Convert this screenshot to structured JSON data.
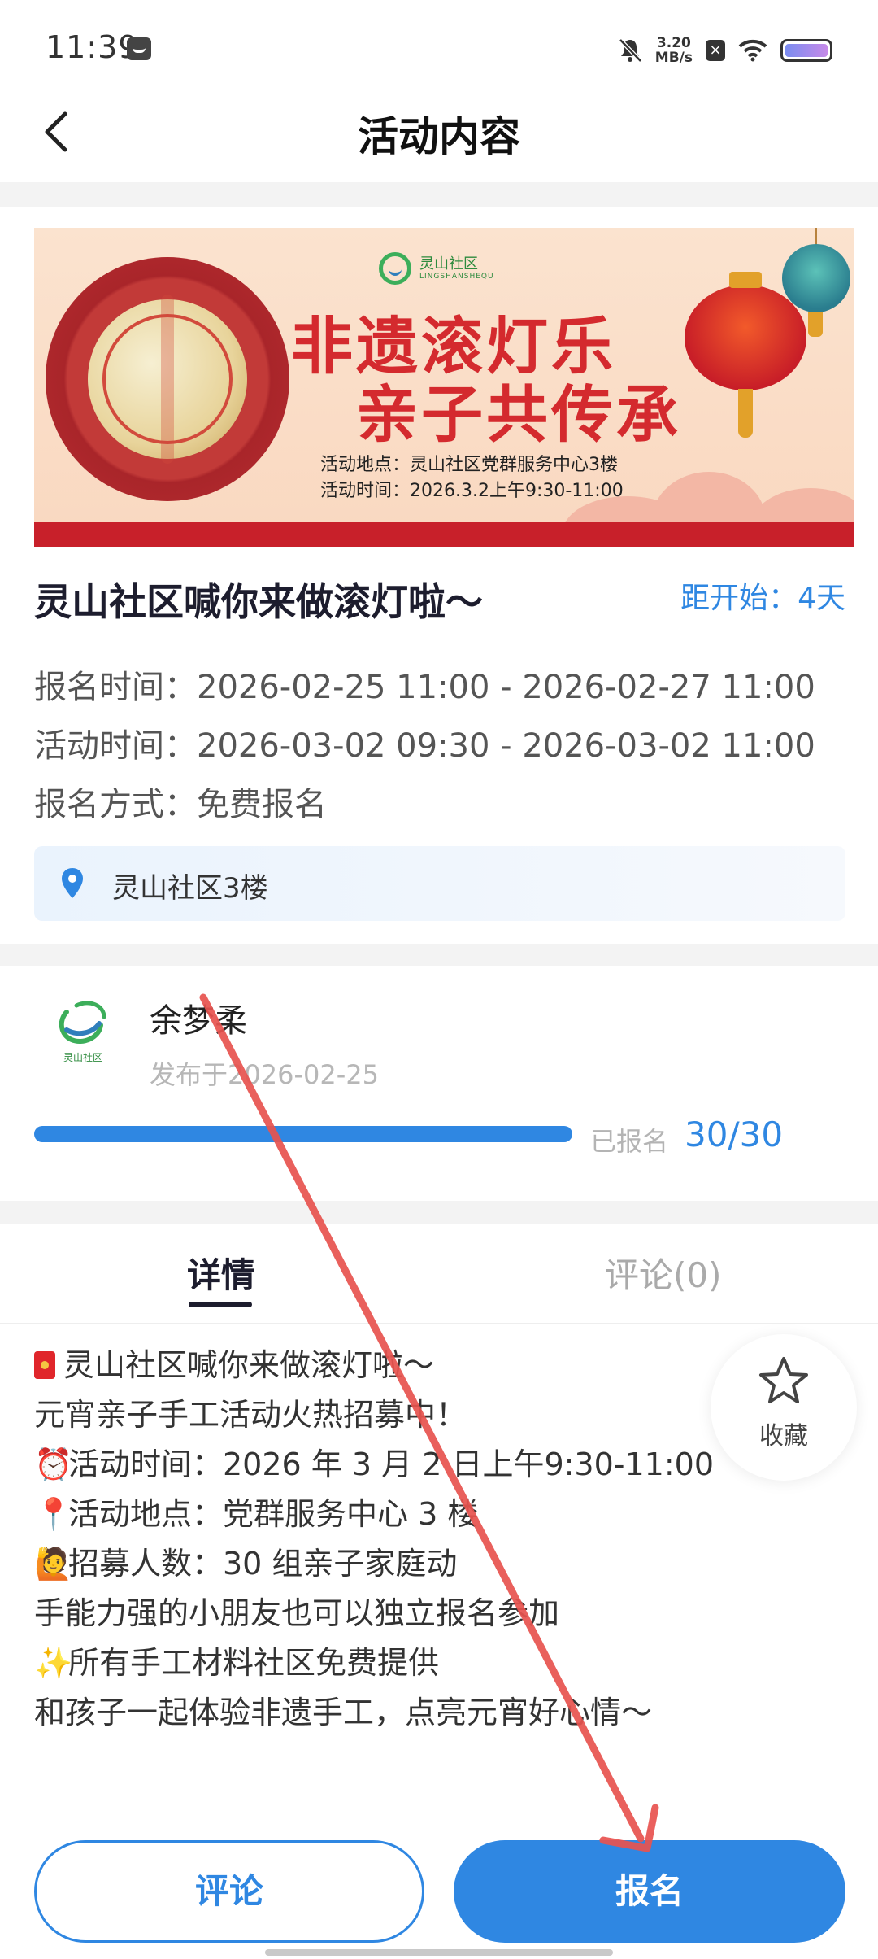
{
  "status_bar": {
    "time": "11:39",
    "net_speed_value": "3.20",
    "net_speed_unit": "MB/s"
  },
  "header": {
    "title": "活动内容"
  },
  "banner": {
    "logo_text": "灵山社区",
    "logo_subtext": "LINGSHANSHEQU",
    "headline_line1": "非遗滚灯乐",
    "headline_line2": "亲子共传承",
    "location_line": "活动地点：灵山社区党群服务中心3楼",
    "time_line": "活动时间：2026.3.2上午9:30-11:00"
  },
  "event": {
    "title": "灵山社区喊你来做滚灯啦～",
    "countdown": "距开始：4天",
    "signup_time_label": "报名时间：",
    "signup_time_value": "2026-02-25 11:00 - 2026-02-27 11:00",
    "activity_time_label": "活动时间：",
    "activity_time_value": "2026-03-02 09:30 - 2026-03-02 11:00",
    "signup_method_label": "报名方式：",
    "signup_method_value": "免费报名",
    "location": "灵山社区3楼"
  },
  "publisher": {
    "name": "余梦柔",
    "published": "发布于2026-02-25",
    "avatar_text": "灵山社区",
    "signed_label": "已报名",
    "signed_count": "30/30",
    "signed_fraction": 1.0
  },
  "tabs": {
    "detail": "详情",
    "comments": "评论(0)"
  },
  "detail": {
    "line1": "灵山社区喊你来做滚灯啦～",
    "line2": "元宵亲子手工活动火热招募中！",
    "line3_emoji": "⏰",
    "line3": "活动时间：2026 年 3 月 2 日上午9:30-11:00",
    "line4_emoji": "📍",
    "line4": "活动地点：党群服务中心 3 楼",
    "line5_emoji": "🙋",
    "line5": "招募人数：30 组亲子家庭动",
    "line6": "手能力强的小朋友也可以独立报名参加",
    "line7_emoji": "✨",
    "line7": "所有手工材料社区免费提供",
    "line8": "和孩子一起体验非遗手工，点亮元宵好心情～"
  },
  "favorite": {
    "label": "收藏"
  },
  "footer": {
    "comment_button": "评论",
    "signup_button": "报名"
  },
  "colors": {
    "accent": "#2f87e2",
    "annotation_arrow": "#e8534f"
  }
}
